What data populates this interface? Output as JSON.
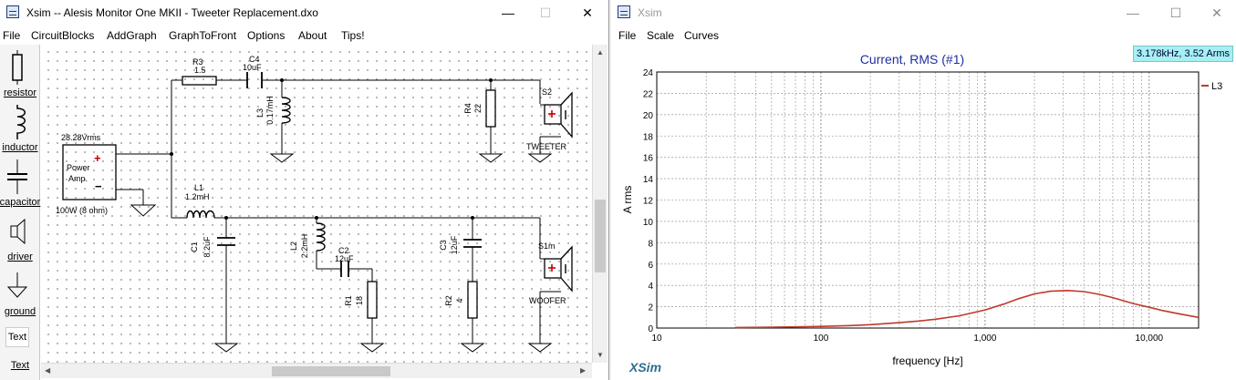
{
  "left_window": {
    "title": "Xsim -- Alesis Monitor One MKII - Tweeter Replacement.dxo",
    "menu": [
      "File",
      "CircuitBlocks",
      "AddGraph",
      "GraphToFront",
      "Options",
      "About",
      "Tips!"
    ],
    "palette": [
      "resistor",
      "inductor",
      "capacitor",
      "driver",
      "ground",
      "Text"
    ],
    "palette_text_button": "Text",
    "controls": {
      "minimize": "—",
      "maximize": "☐",
      "close": "✕"
    }
  },
  "schematic": {
    "amp": {
      "voltage": "28.28Vrms",
      "name_line1": "Power",
      "name_line2": "Amp.",
      "power": "100W (8 ohm)",
      "plus": "+",
      "minus": "−"
    },
    "R3": {
      "name": "R3",
      "value": "1.5"
    },
    "C4": {
      "name": "C4",
      "value": "10uF"
    },
    "L3": {
      "name": "L3",
      "value": "0.17mH"
    },
    "R4": {
      "name": "R4",
      "value": "22"
    },
    "S2": {
      "name": "S2",
      "label": "TWEETER"
    },
    "L1": {
      "name": "L1",
      "value": "1.2mH"
    },
    "C1": {
      "name": "C1",
      "value": "8.2uF"
    },
    "L2": {
      "name": "L2",
      "value": "2.2mH"
    },
    "C2": {
      "name": "C2",
      "value": "12uF"
    },
    "R1": {
      "name": "R1",
      "value": "18"
    },
    "C3": {
      "name": "C3",
      "value": "12uF"
    },
    "R2": {
      "name": "R2",
      "value": "4"
    },
    "S1": {
      "name": "S1m",
      "label": "WOOFER"
    }
  },
  "right_window": {
    "title": "Xsim",
    "menu": [
      "File",
      "Scale",
      "Curves"
    ],
    "readout": "3.178kHz, 3.52 Arms",
    "brand": "XSim",
    "controls": {
      "minimize": "—",
      "maximize": "☐",
      "close": "✕"
    }
  },
  "chart_data": {
    "type": "line",
    "title": "Current, RMS (#1)",
    "xlabel": "frequency [Hz]",
    "ylabel": "A rms",
    "x_scale": "log",
    "xlim": [
      10,
      20000
    ],
    "ylim": [
      0,
      24
    ],
    "x_ticks": [
      10,
      100,
      1000,
      10000
    ],
    "x_tick_labels": [
      "10",
      "100",
      "1,000",
      "10,000"
    ],
    "y_ticks": [
      0,
      2,
      4,
      6,
      8,
      10,
      12,
      14,
      16,
      18,
      20,
      22,
      24
    ],
    "grid": true,
    "legend_position": "right",
    "series": [
      {
        "name": "L3",
        "color": "#c0392b",
        "x": [
          30,
          50,
          100,
          150,
          200,
          300,
          400,
          500,
          700,
          1000,
          1300,
          1600,
          2000,
          2500,
          3178,
          4000,
          5000,
          6000,
          7000,
          8000,
          10000,
          12000,
          15000,
          20000
        ],
        "y": [
          0.05,
          0.08,
          0.15,
          0.23,
          0.32,
          0.5,
          0.67,
          0.83,
          1.15,
          1.7,
          2.25,
          2.75,
          3.2,
          3.45,
          3.52,
          3.42,
          3.15,
          2.85,
          2.55,
          2.3,
          1.95,
          1.65,
          1.35,
          1.0
        ]
      }
    ]
  }
}
